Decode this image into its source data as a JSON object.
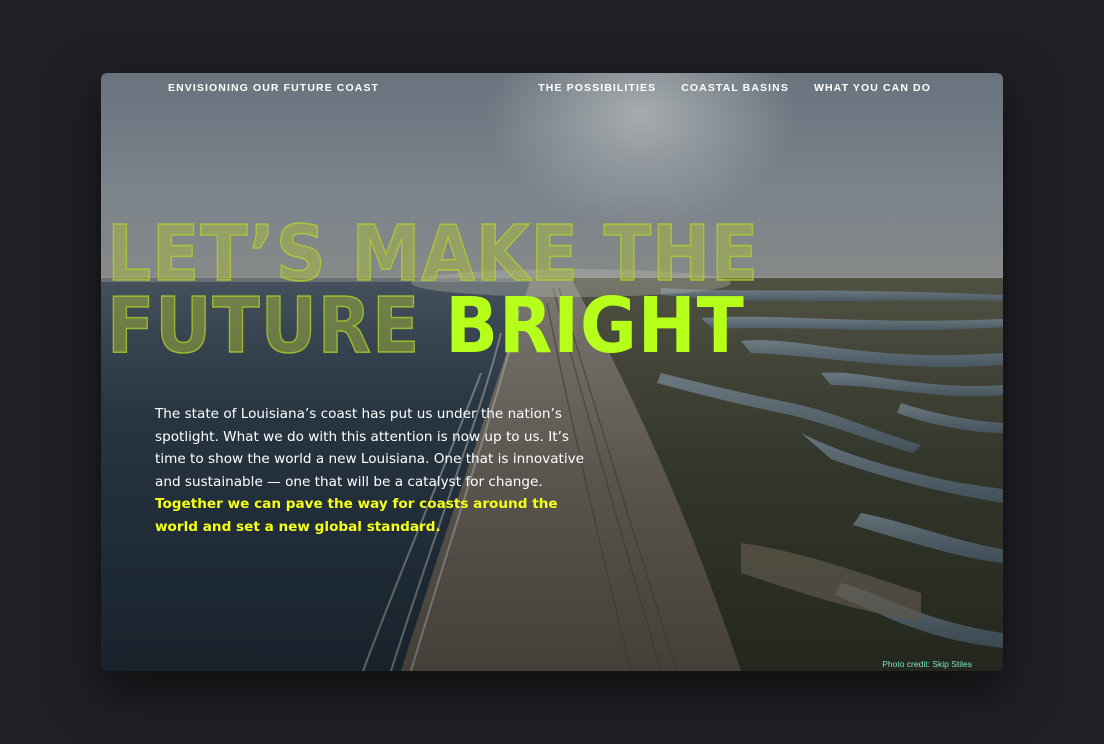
{
  "nav": {
    "brand": "ENVISIONING OUR FUTURE COAST",
    "links": [
      "THE POSSIBILITIES",
      "COASTAL BASINS",
      "WHAT YOU CAN DO"
    ]
  },
  "hero": {
    "headline_line1": "LET’S MAKE THE",
    "headline_line2_outline": "FUTURE",
    "headline_line2_bright": "BRIGHT",
    "paragraph": "The state of Louisiana’s coast has put us under the nation’s spotlight. What we do with this attention is now up to us. It’s time to show the world a new Louisiana. One that is innovative and sustainable — one that will be a catalyst for change.",
    "paragraph_emphasis": "Together we can pave the way for coasts around the world and set a new global standard."
  },
  "photo_credit": "Photo credit: Skip Stiles",
  "colors": {
    "page_background": "#1f1f24",
    "accent_bright": "#b6ff1a",
    "accent_yellow": "#f4ff1c",
    "credit": "#7fe6c6"
  }
}
